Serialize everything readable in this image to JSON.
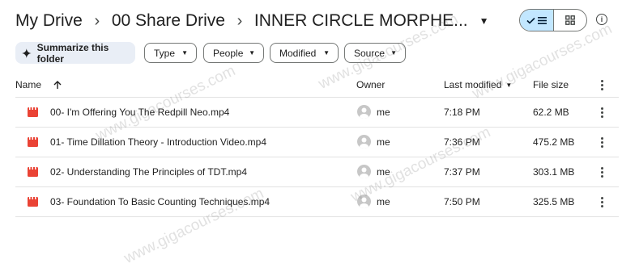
{
  "breadcrumb": {
    "root": "My Drive",
    "middle": "00 Share Drive",
    "current": "INNER CIRCLE MORPHE..."
  },
  "toolbar": {
    "summarize_label": "Summarize this folder",
    "filters": [
      "Type",
      "People",
      "Modified",
      "Source"
    ],
    "view_mode": "list"
  },
  "table": {
    "columns": {
      "name": "Name",
      "owner": "Owner",
      "modified": "Last modified",
      "size": "File size"
    },
    "rows": [
      {
        "name": "00- I'm Offering You The Redpill Neo.mp4",
        "owner": "me",
        "modified": "7:18 PM",
        "size": "62.2 MB"
      },
      {
        "name": "01- Time  Dillation Theory - Introduction Video.mp4",
        "owner": "me",
        "modified": "7:36 PM",
        "size": "475.2 MB"
      },
      {
        "name": "02- Understanding The Principles of TDT.mp4",
        "owner": "me",
        "modified": "7:37 PM",
        "size": "303.1 MB"
      },
      {
        "name": "03- Foundation To Basic Counting Techniques.mp4",
        "owner": "me",
        "modified": "7:50 PM",
        "size": "325.5 MB"
      }
    ]
  },
  "watermark": "www.gigacourses.com",
  "colors": {
    "file_icon": "#ea4335",
    "view_selected": "#c2e7ff",
    "summarize_bg": "#e9eef6"
  }
}
